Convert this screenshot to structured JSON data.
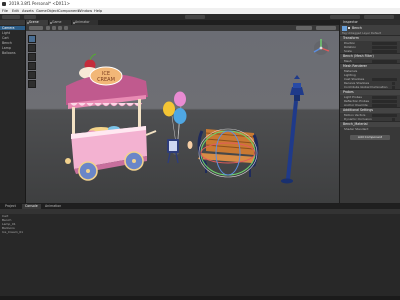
{
  "window": {
    "title": "2019.3.8f1 Personal* <DX11>"
  },
  "menubar": [
    "File",
    "Edit",
    "Assets",
    "GameObject",
    "Component",
    "Window",
    "Help"
  ],
  "hierarchy": {
    "items": [
      "Camera",
      "Light",
      "Cart",
      "Bench",
      "Lamp",
      "Balloons"
    ]
  },
  "scene": {
    "tabs": [
      "Scene",
      "Game",
      "Animator"
    ],
    "sign_text": "ICE CREAM",
    "tool_icons": [
      "hand-icon",
      "move-icon",
      "rotate-icon",
      "scale-icon",
      "rect-icon",
      "transform-icon"
    ],
    "colors": {
      "sky": "#6b6d74",
      "ground": "#3e3f40",
      "awning_pink": "#e98bb4",
      "cart_body": "#f3b2d1",
      "wheel_blue": "#6a86c8"
    }
  },
  "inspector": {
    "tab": "Inspector",
    "object_name": "Bench",
    "tag_row": "Tag Untagged   Layer Default",
    "sections": [
      {
        "title": "Transform",
        "props": [
          "Position",
          "Rotation",
          "Scale"
        ]
      },
      {
        "title": "Bench (Mesh Filter)",
        "props": [
          "Mesh"
        ]
      },
      {
        "title": "Mesh Renderer",
        "props": [
          "Materials",
          "Lighting",
          "Cast Shadows",
          "Receive Shadows",
          "Contribute Global Illumination"
        ]
      },
      {
        "title": "Probes",
        "props": [
          "Light Probes",
          "Reflection Probes",
          "Anchor Override"
        ]
      },
      {
        "title": "Additional Settings",
        "props": [
          "Motion Vectors",
          "Dynamic Occlusion"
        ]
      }
    ],
    "material_label": "Bench_Material",
    "shader_label": "Shader  Standard",
    "add_component": "Add Component"
  },
  "bottom": {
    "tabs": [
      "Project",
      "Console",
      "Animation"
    ],
    "console_lines": [
      "Cart",
      "Bench",
      "Lamp_01",
      "Balloons",
      "Ice_Cream_01"
    ]
  }
}
